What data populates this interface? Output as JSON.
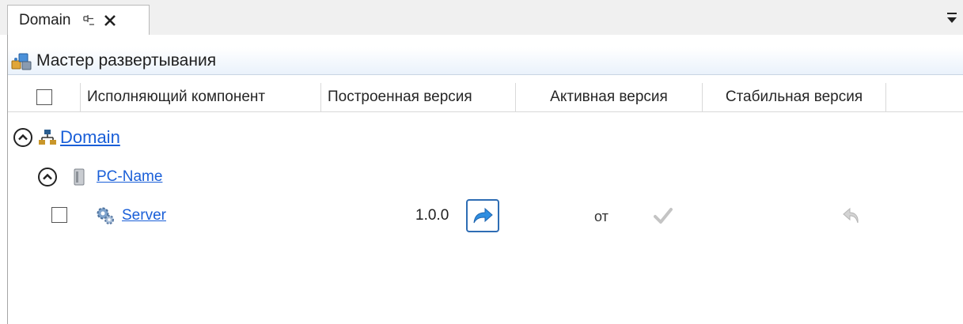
{
  "tab": {
    "label": "Domain"
  },
  "panel": {
    "title": "Мастер развертывания"
  },
  "columns": [
    "Исполняющий компонент",
    "Построенная версия",
    "Активная версия",
    "Стабильная версия"
  ],
  "tree": {
    "domain": {
      "label": "Domain",
      "expanded": true
    },
    "computer": {
      "label": "PC-Name",
      "expanded": true
    },
    "component": {
      "label": "Server",
      "built_version": "1.0.0",
      "active_version": "от",
      "checked": false
    }
  },
  "icons": {
    "pin": "pin-icon",
    "close": "close-icon",
    "overflow": "dropdown-overflow-icon",
    "wizard": "deployment-wizard-icon",
    "network": "network-icon",
    "computer": "computer-icon",
    "gear": "gear-icon",
    "deploy": "deploy-arrow-icon",
    "check": "check-icon",
    "revert": "revert-icon"
  },
  "colors": {
    "link": "#1a5fd8",
    "deploy_border": "#2e6db4",
    "header_bg": "#eaf2fb"
  }
}
